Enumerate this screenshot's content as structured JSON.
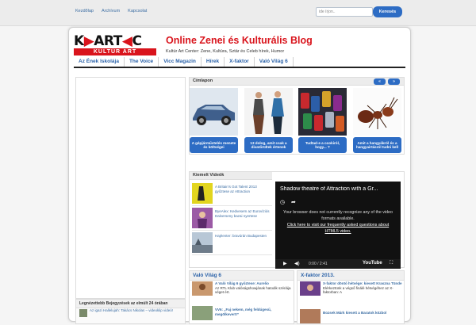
{
  "topbar": {
    "nav": [
      "Kezdőlap",
      "Archívum",
      "Kapcsolat"
    ],
    "search_placeholder": "ide írjon..",
    "search_button": "Keresés"
  },
  "header": {
    "logo_top": "KARTC",
    "logo_bottom": "KULTÚR ART",
    "title": "Online Zenei és Kulturális Blog",
    "tagline": "Kultúr Art Center: Zene, Kultúra, Sztár és Celeb hírek, Humor"
  },
  "mainnav": [
    "Az Ének Iskolája",
    "The Voice",
    "Vicc Magazin",
    "Hírek",
    "X-faktor",
    "Való Világ 6"
  ],
  "sidebar": {
    "recent_title": "Legnézettebb Bejegyzések az elmúlt 24 órában",
    "recent_item": "Az igazi Hallelujah: Takács Nikolas – videoklip videó!"
  },
  "featured": {
    "title": "Címlapon",
    "prev": "«",
    "next": "»",
    "cards": [
      {
        "caption": "A gépjárművtelés menete és költségei"
      },
      {
        "caption": "13 dolog, amit csak a divatőrültek értenek"
      },
      {
        "caption": "Tudtad-e a cookiról, hogy... ?"
      },
      {
        "caption": "Amit a hangyákról és a hangyairtásról tudni kell"
      }
    ]
  },
  "videos": {
    "title": "Kiemelt Videók",
    "items": [
      {
        "text": "A Britain's Got Talent 2013 győztese az Attraction"
      },
      {
        "text": "ByeAlex: Kedvesem az Eurovíziós Dalverseny bazai nyertese"
      },
      {
        "text": "Hajéenter: bravúrán Budapesten"
      }
    ],
    "player_title": "Shadow theatre of Attraction with a Gr...",
    "player_msg_1": "Your browser does not currently recognize any of the video formats available.",
    "player_msg_2": "Click here to visit our frequently asked questions about HTML5 video.",
    "player_time": "0:00 / 2:41",
    "player_brand": "YouTube"
  },
  "valo_vilag": {
    "title": "Való Világ 6",
    "item1_title": "A Való Világ 6 győztese: Aurelio",
    "item1_text": "Az RTL Klub valóságshowjának hatodik szériája véget ért.",
    "item2_title": "VV6: „Faj nekem, még feldúgesű, megölkevert!”"
  },
  "xfaktor": {
    "title": "X-faktor 2013.",
    "item1_title": "X-faktor döntő hétvége: kiesett Kraszna Tünde",
    "item1_text": "Elérkeztünk a végső finálé hétvégéhez az X-faktorban: A",
    "item2_title": "Bozsek Márk kiesett a Baratok közbol"
  }
}
